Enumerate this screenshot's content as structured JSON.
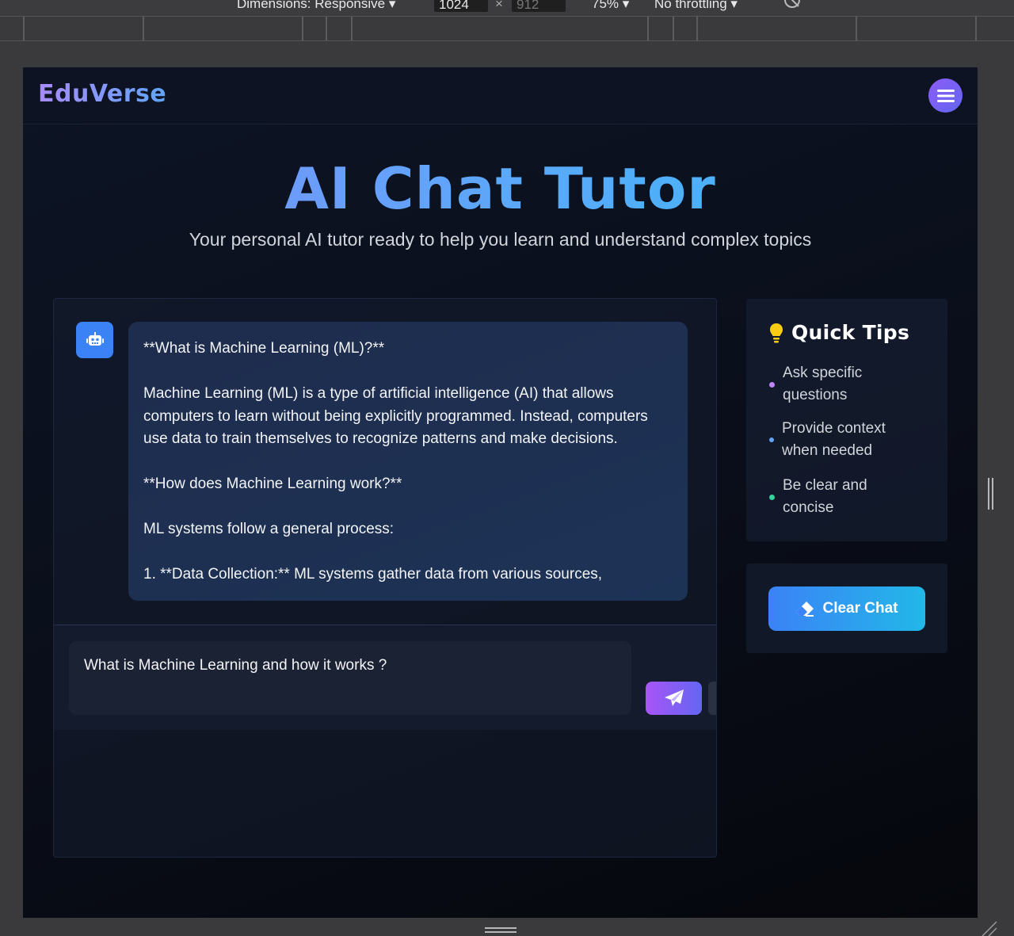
{
  "devtools": {
    "dimensions_label": "Dimensions: Responsive",
    "width": "1024",
    "height": "912",
    "times": "×",
    "zoom": "75%",
    "throttling": "No throttling"
  },
  "nav": {
    "logo": "EduVerse",
    "menu_icon": "menu-icon"
  },
  "hero": {
    "title": "AI Chat Tutor",
    "subtitle": "Your personal AI tutor ready to help you learn and understand complex topics"
  },
  "chat": {
    "bot_icon": "robot-icon",
    "message_paragraphs": [
      "**What is Machine Learning (ML)?**",
      "Machine Learning (ML) is a type of artificial intelligence (AI) that allows computers to learn without being explicitly programmed. Instead, computers use data to train themselves to recognize patterns and make decisions.",
      "**How does Machine Learning work?**",
      "ML systems follow a general process:",
      "1. **Data Collection:** ML systems gather data from various sources,"
    ],
    "input_value": "What is Machine Learning and how it works ?",
    "send_icon": "paper-plane-icon"
  },
  "tips": {
    "title": "Quick Tips",
    "icon": "lightbulb-icon",
    "items": [
      {
        "text": "Ask specific questions",
        "color": "#c084fc"
      },
      {
        "text": "Provide context when needed",
        "color": "#60a5fa"
      },
      {
        "text": "Be clear and concise",
        "color": "#34d399"
      }
    ]
  },
  "actions": {
    "clear_label": "Clear Chat",
    "clear_icon": "eraser-icon"
  }
}
